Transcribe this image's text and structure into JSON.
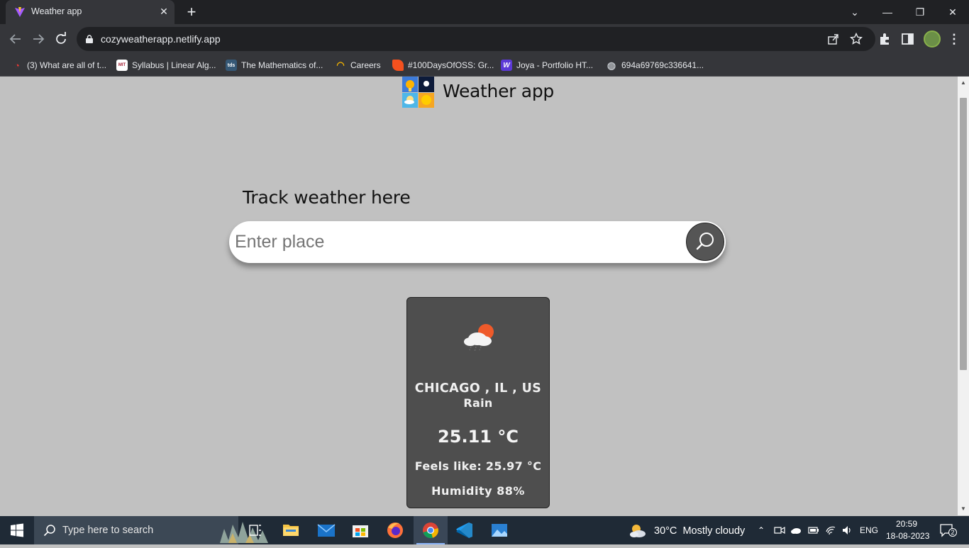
{
  "browser": {
    "tab_title": "Weather app",
    "url": "cozyweatherapp.netlify.app",
    "bookmarks": [
      "(3) What are all of t...",
      "Syllabus | Linear Alg...",
      "The Mathematics of...",
      "Careers",
      "#100DaysOfOSS: Gr...",
      "Joya - Portfolio HT...",
      "694a69769c336641..."
    ],
    "bookmark_badges": [
      "MIT",
      "tds",
      "W"
    ]
  },
  "app": {
    "title": "Weather app",
    "heading": "Track weather here",
    "search": {
      "placeholder": "Enter place",
      "value": ""
    },
    "card": {
      "icon": "cloud-rain-sun-icon",
      "location": "CHICAGO , IL , US",
      "condition": "Rain",
      "temperature": "25.11 °C",
      "feels_like": "Feels like: 25.97 °C",
      "humidity": "Humidity 88%"
    },
    "colors": {
      "background": "#c1c1c1",
      "card": "#4e4e4e",
      "search_button": "#555555"
    }
  },
  "taskbar": {
    "search_placeholder": "Type here to search",
    "weather": "30°C  Mostly cloudy",
    "language": "ENG",
    "time": "20:59",
    "date": "18-08-2023",
    "notification_count": "2"
  }
}
